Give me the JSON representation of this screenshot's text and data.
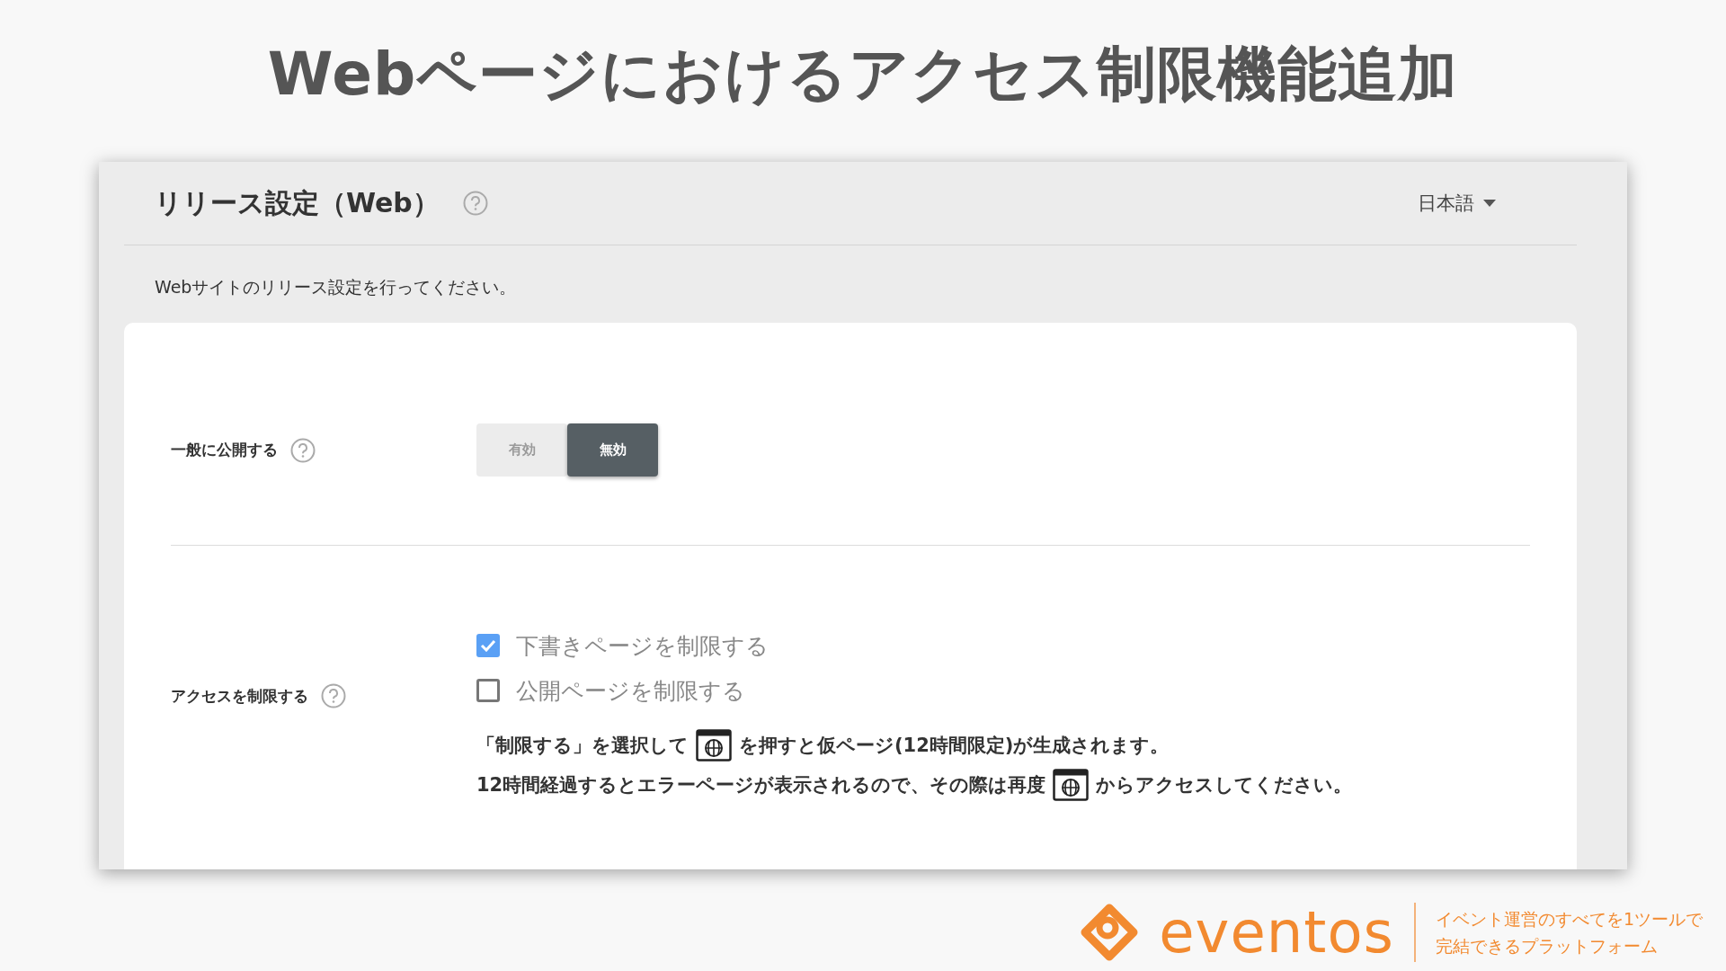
{
  "slide_title": "Webページにおけるアクセス制限機能追加",
  "window": {
    "title": "リリース設定（Web）",
    "language": "日本語",
    "description": "Webサイトのリリース設定を行ってください。"
  },
  "public_setting": {
    "label": "一般に公開する",
    "options": [
      {
        "label": "有効",
        "selected": false
      },
      {
        "label": "無効",
        "selected": true
      }
    ]
  },
  "access_setting": {
    "label": "アクセスを制限する",
    "checkboxes": [
      {
        "label": "下書きページを制限する",
        "checked": true
      },
      {
        "label": "公開ページを制限する",
        "checked": false
      }
    ],
    "notes": [
      {
        "before": "「制限する」を選択して",
        "after": "を押すと仮ページ(12時間限定)が生成されます。"
      },
      {
        "before": "12時間経過するとエラーページが表示されるので、その際は再度",
        "after": "からアクセスしてください。"
      }
    ]
  },
  "footer": {
    "brand": "eventos",
    "tagline": [
      "イベント運営のすべてを1ツールで",
      "完結できるプラットフォーム"
    ]
  }
}
